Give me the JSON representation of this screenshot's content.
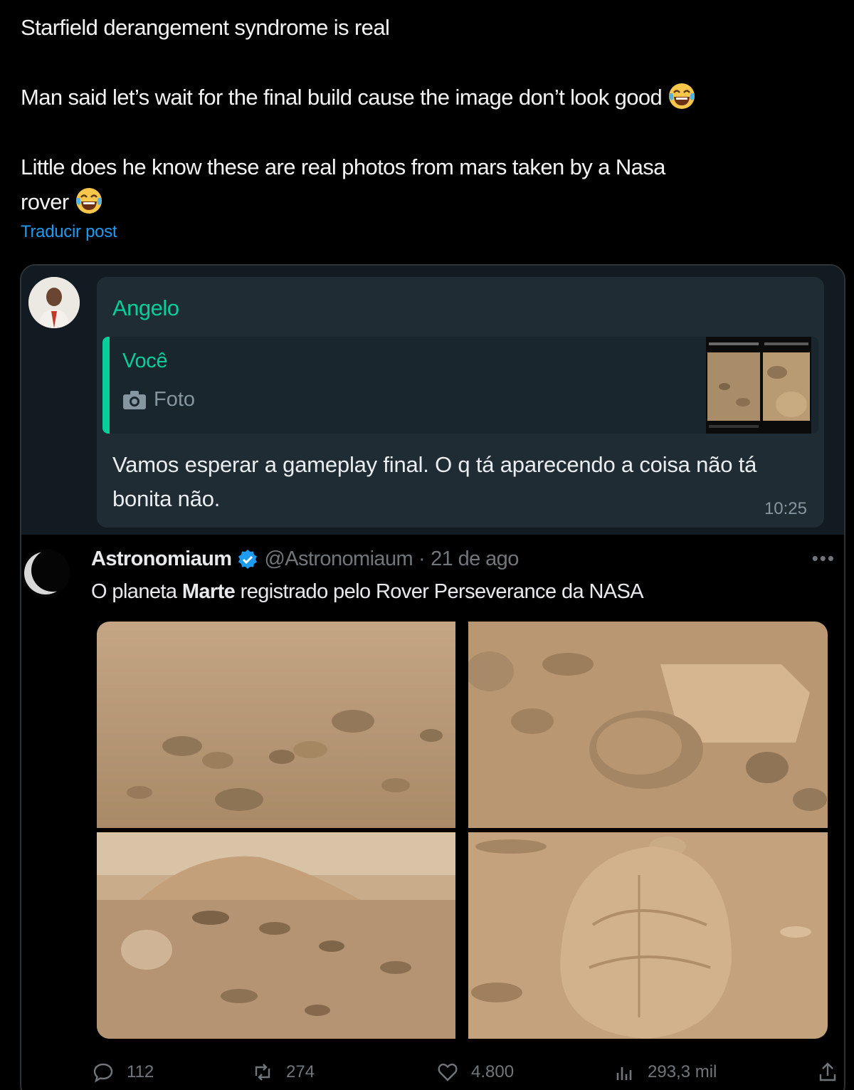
{
  "post": {
    "line1": "Starfield derangement syndrome is real",
    "line2": "Man said let’s wait for the final build cause the image don’t look good",
    "line3a": "Little does he know these are real photos from mars taken by a Nasa",
    "line3b": "rover",
    "emoji": "face-with-tears-of-joy",
    "translate_label": "Traducir post"
  },
  "whatsapp": {
    "sender": "Angelo",
    "reply_to_name": "Você",
    "reply_media_icon": "camera-icon",
    "reply_media_label": "Foto",
    "message": "Vamos esperar a gameplay final. O q tá aparecendo a coisa não tá bonita não.",
    "time": "10:25",
    "accent_color": "#06cf9c"
  },
  "quoted_tweet": {
    "name": "Astronomiaum",
    "verified": true,
    "handle": "@Astronomiaum",
    "separator": "·",
    "date": "21 de ago",
    "text_before": "O planeta ",
    "text_bold": "Marte",
    "text_after": " registrado pelo Rover Perseverance da NASA",
    "photos": [
      "mars-rocky-plain",
      "mars-large-boulders",
      "mars-hill-and-rocks",
      "mars-big-rock-closeup"
    ]
  },
  "actions": {
    "replies": "112",
    "reposts": "274",
    "likes": "4.800",
    "views": "293,3 mil"
  },
  "colors": {
    "background": "#000000",
    "link": "#1d9bf0",
    "muted": "#71767b",
    "verified": "#1d9bf0"
  }
}
